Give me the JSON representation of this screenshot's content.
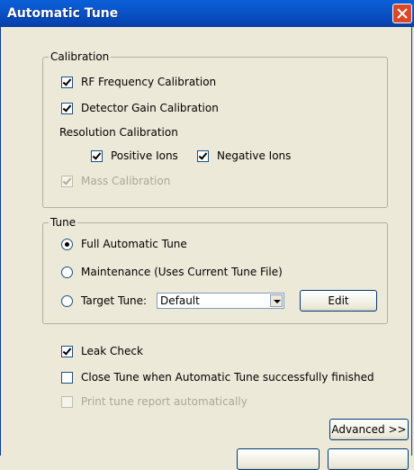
{
  "window": {
    "title": "Automatic Tune"
  },
  "calibration": {
    "legend": "Calibration",
    "rf_frequency": {
      "label": "RF Frequency Calibration",
      "checked": true
    },
    "detector_gain": {
      "label": "Detector Gain Calibration",
      "checked": true
    },
    "resolution_label": "Resolution Calibration",
    "positive_ions": {
      "label": "Positive Ions",
      "checked": true
    },
    "negative_ions": {
      "label": "Negative Ions",
      "checked": true
    },
    "mass_calibration": {
      "label": "Mass Calibration",
      "checked": true,
      "disabled": true
    }
  },
  "tune": {
    "legend": "Tune",
    "full_automatic": {
      "label": "Full Automatic Tune",
      "selected": true
    },
    "maintenance": {
      "label": "Maintenance (Uses Current Tune File)",
      "selected": false
    },
    "target_tune": {
      "label": "Target Tune:",
      "selected": false
    },
    "target_select": {
      "value": "Default"
    },
    "edit_button": "Edit"
  },
  "options": {
    "leak_check": {
      "label": "Leak Check",
      "checked": true
    },
    "close_tune": {
      "label": "Close Tune when Automatic Tune successfully finished",
      "checked": false
    },
    "print_report": {
      "label": "Print tune report automatically",
      "checked": false,
      "disabled": true
    }
  },
  "buttons": {
    "advanced": "Advanced >>"
  }
}
